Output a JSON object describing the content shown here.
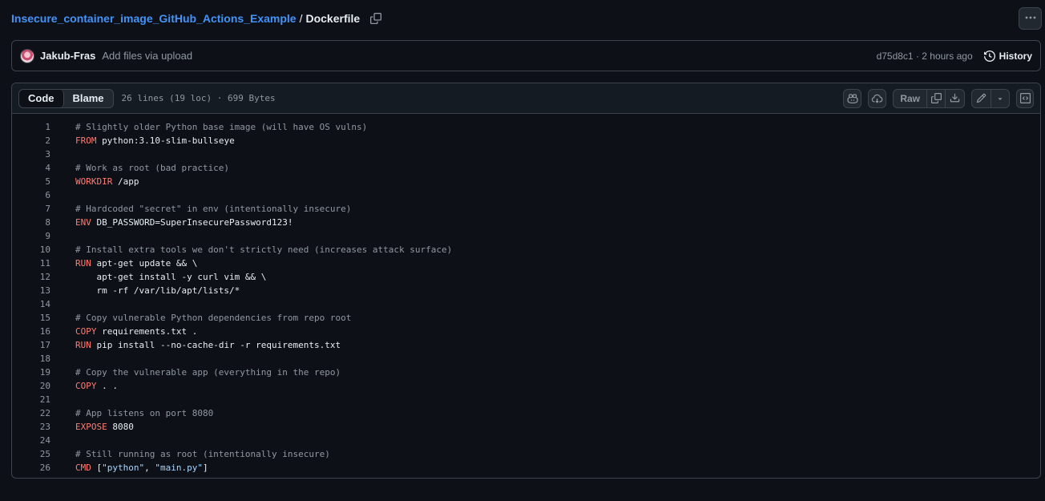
{
  "breadcrumb": {
    "repo": "Insecure_container_image_GitHub_Actions_Example",
    "separator": "/",
    "file": "Dockerfile"
  },
  "commit": {
    "author": "Jakub-Fras",
    "message": "Add files via upload",
    "sha_time": "d75d8c1 · 2 hours ago",
    "history_label": "History"
  },
  "file_header": {
    "tabs": [
      "Code",
      "Blame"
    ],
    "active_tab": "Code",
    "info": "26 lines (19 loc) · 699 Bytes",
    "raw_label": "Raw"
  },
  "icons": {
    "copy_path": "copy-icon",
    "more": "kebab-horizontal-icon",
    "history": "history-icon",
    "copilot": "copilot-icon",
    "codespaces": "cloud-icon",
    "copy_raw": "copy-icon",
    "download": "download-icon",
    "edit": "pencil-icon",
    "dropdown": "triangle-down-icon",
    "symbols": "code-square-icon"
  },
  "colors": {
    "link": "#4493f8",
    "keyword": "#ff7b72",
    "comment": "#9198a1",
    "string": "#a5d6ff"
  },
  "code_lines": [
    {
      "n": "1",
      "tokens": [
        {
          "t": "comment",
          "v": "# Slightly older Python base image (will have OS vulns)"
        }
      ]
    },
    {
      "n": "2",
      "tokens": [
        {
          "t": "keyword",
          "v": "FROM"
        },
        {
          "t": "plain",
          "v": " python:3.10-slim-bullseye"
        }
      ]
    },
    {
      "n": "3",
      "tokens": []
    },
    {
      "n": "4",
      "tokens": [
        {
          "t": "comment",
          "v": "# Work as root (bad practice)"
        }
      ]
    },
    {
      "n": "5",
      "tokens": [
        {
          "t": "keyword",
          "v": "WORKDIR"
        },
        {
          "t": "plain",
          "v": " /app"
        }
      ]
    },
    {
      "n": "6",
      "tokens": []
    },
    {
      "n": "7",
      "tokens": [
        {
          "t": "comment",
          "v": "# Hardcoded \"secret\" in env (intentionally insecure)"
        }
      ]
    },
    {
      "n": "8",
      "tokens": [
        {
          "t": "keyword",
          "v": "ENV"
        },
        {
          "t": "plain",
          "v": " DB_PASSWORD=SuperInsecurePassword123!"
        }
      ]
    },
    {
      "n": "9",
      "tokens": []
    },
    {
      "n": "10",
      "tokens": [
        {
          "t": "comment",
          "v": "# Install extra tools we don't strictly need (increases attack surface)"
        }
      ]
    },
    {
      "n": "11",
      "tokens": [
        {
          "t": "keyword",
          "v": "RUN"
        },
        {
          "t": "plain",
          "v": " apt-get update && \\"
        }
      ]
    },
    {
      "n": "12",
      "tokens": [
        {
          "t": "plain",
          "v": "    apt-get install -y curl vim && \\"
        }
      ]
    },
    {
      "n": "13",
      "tokens": [
        {
          "t": "plain",
          "v": "    rm -rf /var/lib/apt/lists/*"
        }
      ]
    },
    {
      "n": "14",
      "tokens": []
    },
    {
      "n": "15",
      "tokens": [
        {
          "t": "comment",
          "v": "# Copy vulnerable Python dependencies from repo root"
        }
      ]
    },
    {
      "n": "16",
      "tokens": [
        {
          "t": "keyword",
          "v": "COPY"
        },
        {
          "t": "plain",
          "v": " requirements.txt ."
        }
      ]
    },
    {
      "n": "17",
      "tokens": [
        {
          "t": "keyword",
          "v": "RUN"
        },
        {
          "t": "plain",
          "v": " pip install --no-cache-dir -r requirements.txt"
        }
      ]
    },
    {
      "n": "18",
      "tokens": []
    },
    {
      "n": "19",
      "tokens": [
        {
          "t": "comment",
          "v": "# Copy the vulnerable app (everything in the repo)"
        }
      ]
    },
    {
      "n": "20",
      "tokens": [
        {
          "t": "keyword",
          "v": "COPY"
        },
        {
          "t": "plain",
          "v": " . ."
        }
      ]
    },
    {
      "n": "21",
      "tokens": []
    },
    {
      "n": "22",
      "tokens": [
        {
          "t": "comment",
          "v": "# App listens on port 8080"
        }
      ]
    },
    {
      "n": "23",
      "tokens": [
        {
          "t": "keyword",
          "v": "EXPOSE"
        },
        {
          "t": "plain",
          "v": " 8080"
        }
      ]
    },
    {
      "n": "24",
      "tokens": []
    },
    {
      "n": "25",
      "tokens": [
        {
          "t": "comment",
          "v": "# Still running as root (intentionally insecure)"
        }
      ]
    },
    {
      "n": "26",
      "tokens": [
        {
          "t": "keyword",
          "v": "CMD"
        },
        {
          "t": "plain",
          "v": " ["
        },
        {
          "t": "string",
          "v": "\"python\""
        },
        {
          "t": "plain",
          "v": ", "
        },
        {
          "t": "string",
          "v": "\"main.py\""
        },
        {
          "t": "plain",
          "v": "]"
        }
      ]
    }
  ]
}
